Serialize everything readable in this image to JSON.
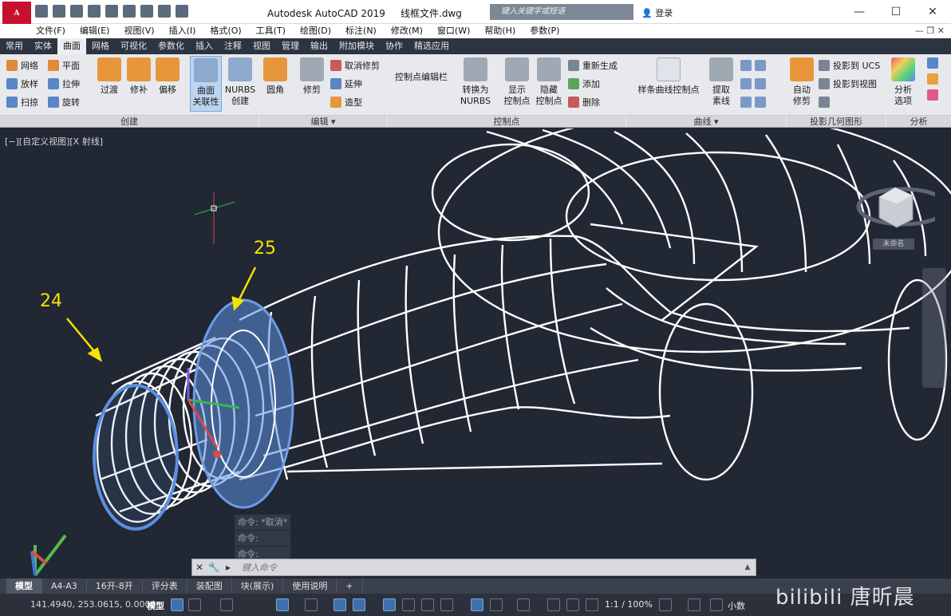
{
  "title": {
    "app_title": "Autodesk AutoCAD 2019",
    "file_name": "线框文件.dwg",
    "search_placeholder": "键入关键字或短语",
    "sign_in": "登录",
    "logo_letter": "A"
  },
  "menu": {
    "items": [
      "文件(F)",
      "编辑(E)",
      "视图(V)",
      "插入(I)",
      "格式(O)",
      "工具(T)",
      "绘图(D)",
      "标注(N)",
      "修改(M)",
      "窗口(W)",
      "帮助(H)",
      "参数(P)"
    ]
  },
  "ribbon_tabs": [
    "常用",
    "实体",
    "曲面",
    "网格",
    "可视化",
    "参数化",
    "插入",
    "注释",
    "视图",
    "管理",
    "输出",
    "附加模块",
    "协作",
    "精选应用"
  ],
  "ribbon_active_tab": "曲面",
  "ribbon": {
    "create": {
      "title": "创建",
      "small": [
        "网络",
        "平面",
        "放样",
        "拉伸",
        "扫掠",
        "旋转"
      ],
      "big": [
        "过渡",
        "修补",
        "偏移"
      ],
      "assoc_line1": "曲面",
      "assoc_line2": "关联性",
      "nurbs_line1": "NURBS",
      "nurbs_line2": "创建"
    },
    "edit": {
      "title": "编辑",
      "fillet": "圆角",
      "trim": "修剪",
      "untrim": "取消修剪",
      "extend": "延伸",
      "sculpt": "造型"
    },
    "control_points": {
      "title": "控制点",
      "cv_edit_bar": "控制点编辑栏",
      "convert_line1": "转换为",
      "convert_line2": "NURBS",
      "show_line1": "显示",
      "show_line2": "控制点",
      "hide_line1": "隐藏",
      "hide_line2": "控制点",
      "rebuild": "重新生成",
      "add": "添加",
      "remove": "删除"
    },
    "curves": {
      "title": "曲线",
      "spline_cv": "样条曲线控制点",
      "extract_line1": "提取",
      "extract_line2": "素线"
    },
    "projection": {
      "title": "投影几何图形",
      "auto_line1": "自动",
      "auto_line2": "修剪",
      "to_ucs": "投影到 UCS",
      "to_view": "投影到视图"
    },
    "analysis": {
      "title": "分析",
      "options_line1": "分析",
      "options_line2": "选项"
    }
  },
  "viewport": {
    "label": "[−][自定义视图][X 射线]",
    "viewcube_label": "未命名",
    "callout_24": "24",
    "callout_25": "25",
    "command_history": [
      "命令: *取消*",
      "命令:",
      "命令:"
    ],
    "command_placeholder": "键入命令"
  },
  "layout_tabs": [
    "模型",
    "A4-A3",
    "16开-8开",
    "评分表",
    "装配图",
    "块(展示)",
    "使用说明"
  ],
  "layout_active": "模型",
  "status": {
    "coords": "141.4940, 253.0615, 0.0000",
    "model": "模型",
    "scale": "1:1 / 100%",
    "units": "小数"
  },
  "watermark": "bilibili 唐昕晨",
  "colors": {
    "selection": "#5b8fe0",
    "wire": "#ffffff",
    "callout": "#f5e400",
    "viewport_bg": "#212733"
  }
}
